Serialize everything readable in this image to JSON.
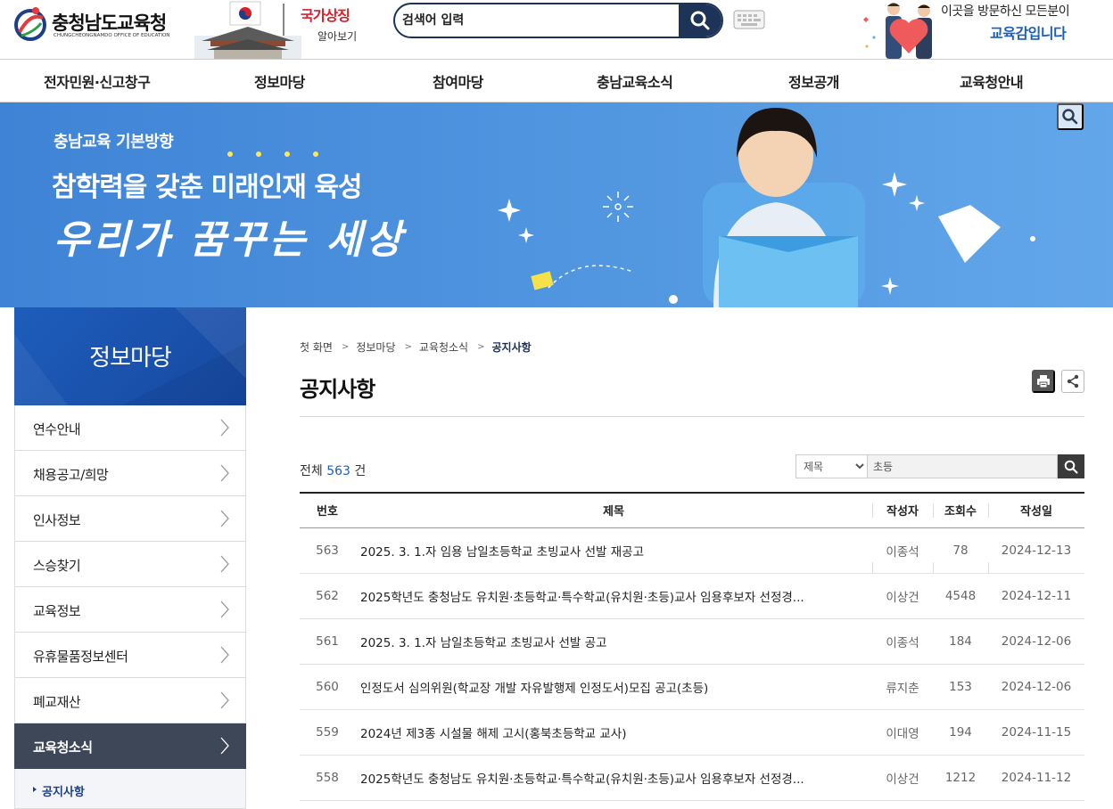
{
  "header": {
    "logo_title": "충청남도교육청",
    "logo_subtitle": "CHUNGCHEONGNAMDO OFFICE OF EDUCATION",
    "symbol_banner_line1": "국가상징",
    "symbol_banner_line2": "알아보기",
    "search_placeholder": "검색어 입력",
    "greeting_line1": "이곳을 방문하신 모든분이",
    "greeting_line2": "교육감입니다"
  },
  "gnb": {
    "items": [
      "전자민원·신고창구",
      "정보마당",
      "참여마당",
      "충남교육소식",
      "정보공개",
      "교육청안내"
    ]
  },
  "hero": {
    "subtitle": "충남교육 기본방향",
    "headline": "참학력을 갖춘 미래인재 육성",
    "script": "우리가 꿈꾸는 세상"
  },
  "sidebar": {
    "title": "정보마당",
    "items": [
      {
        "label": "연수안내"
      },
      {
        "label": "채용공고/희망"
      },
      {
        "label": "인사정보"
      },
      {
        "label": "스승찾기"
      },
      {
        "label": "교육정보"
      },
      {
        "label": "유휴물품정보센터"
      },
      {
        "label": "폐교재산"
      },
      {
        "label": "교육청소식"
      }
    ],
    "sub_item": "공지사항"
  },
  "breadcrumb": [
    "첫 화면",
    "정보마당",
    "교육청소식",
    "공지사항"
  ],
  "page_title": "공지사항",
  "list": {
    "total_prefix": "전체",
    "total_count": "563",
    "total_suffix": "건",
    "filter_selected": "제목",
    "filter_value": "초등",
    "columns": [
      "번호",
      "제목",
      "작성자",
      "조회수",
      "작성일"
    ],
    "rows": [
      {
        "no": "563",
        "title": "2025. 3. 1.자 임용 남일초등학교 초빙교사 선발 재공고",
        "author": "이종석",
        "views": "78",
        "date": "2024-12-13"
      },
      {
        "no": "562",
        "title": "2025학년도 충청남도 유치원·초등학교·특수학교(유치원·초등)교사 임용후보자 선정경...",
        "author": "이상건",
        "views": "4548",
        "date": "2024-12-11"
      },
      {
        "no": "561",
        "title": "2025. 3. 1.자 남일초등학교 초빙교사 선발 공고",
        "author": "이종석",
        "views": "184",
        "date": "2024-12-06"
      },
      {
        "no": "560",
        "title": "인정도서 심의위원(학교장 개발 자유발행제 인정도서)모집 공고(초등)",
        "author": "류지춘",
        "views": "153",
        "date": "2024-12-06"
      },
      {
        "no": "559",
        "title": "2024년 제3종 시설물 해제 고시(홍북초등학교 교사)",
        "author": "이대영",
        "views": "194",
        "date": "2024-11-15"
      },
      {
        "no": "558",
        "title": "2025학년도 충청남도 유치원·초등학교·특수학교(유치원·초등)교사 임용후보자 선정경...",
        "author": "이상건",
        "views": "1212",
        "date": "2024-11-12"
      }
    ]
  },
  "colors": {
    "navy": "#1d3358",
    "brand_blue": "#1e5dbb",
    "active_menu": "#3d4757",
    "link_blue": "#1b5fb8",
    "symbol_red": "#d81f2a"
  },
  "icons": {
    "search": "search-icon",
    "keyboard": "keyboard-icon",
    "print": "print-icon",
    "share": "share-icon",
    "chevron": "chevron-right-icon"
  }
}
